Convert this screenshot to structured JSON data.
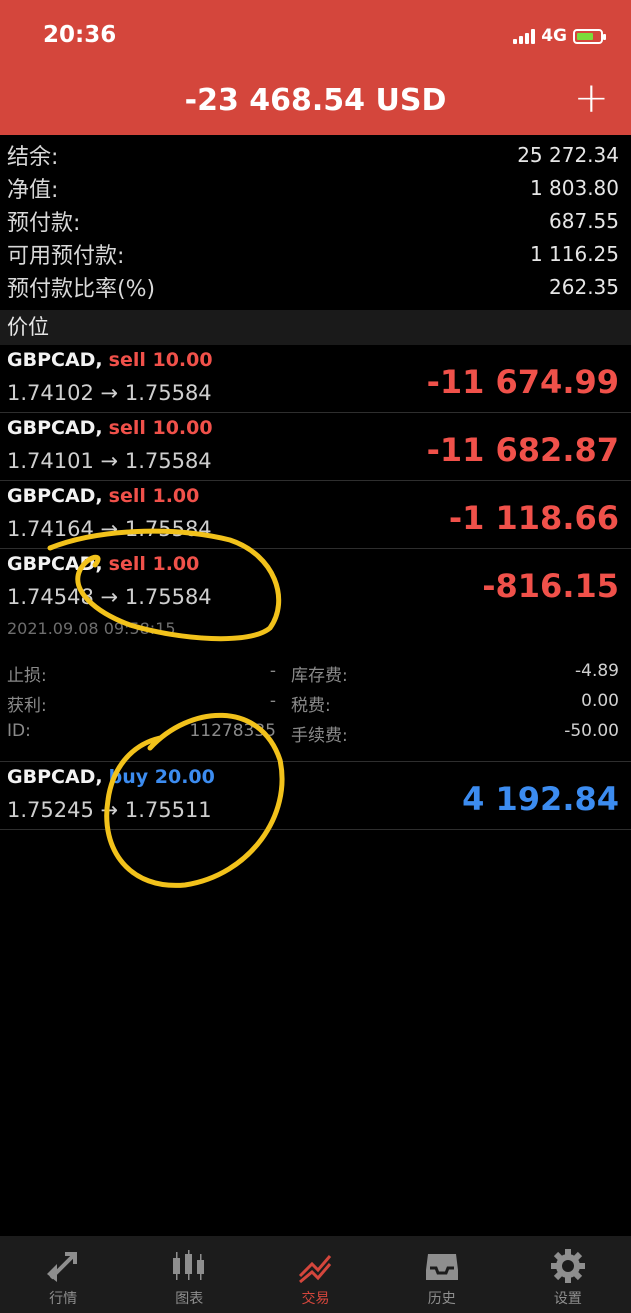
{
  "status": {
    "time": "20:36",
    "network": "4G"
  },
  "header": {
    "title": "-23 468.54 USD",
    "add_label": "+"
  },
  "summary": [
    {
      "label": "结余:",
      "value": "25 272.34"
    },
    {
      "label": "净值:",
      "value": "1 803.80"
    },
    {
      "label": "预付款:",
      "value": "687.55"
    },
    {
      "label": "可用预付款:",
      "value": "1 116.25"
    },
    {
      "label": "预付款比率(%)",
      "value": "262.35"
    }
  ],
  "section": {
    "title": "价位"
  },
  "positions": [
    {
      "symbol": "GBPCAD,",
      "side": "sell 10.00",
      "open": "1.74102",
      "arrow": "→",
      "current": "1.75584",
      "profit": "-11 674.99",
      "type": "sell"
    },
    {
      "symbol": "GBPCAD,",
      "side": "sell 10.00",
      "open": "1.74101",
      "arrow": "→",
      "current": "1.75584",
      "profit": "-11 682.87",
      "type": "sell"
    },
    {
      "symbol": "GBPCAD,",
      "side": "sell 1.00",
      "open": "1.74164",
      "arrow": "→",
      "current": "1.75584",
      "profit": "-1 118.66",
      "type": "sell"
    },
    {
      "symbol": "GBPCAD,",
      "side": "sell 1.00",
      "open": "1.74548",
      "arrow": "→",
      "current": "1.75584",
      "profit": "-816.15",
      "type": "sell"
    },
    {
      "symbol": "GBPCAD,",
      "side": "buy 20.00",
      "open": "1.75245",
      "arrow": "→",
      "current": "1.75511",
      "profit": "4 192.84",
      "type": "buy"
    }
  ],
  "detail": {
    "time": "2021.09.08 09:58:15",
    "stop_loss_label": "止损:",
    "stop_loss_value": "-",
    "swap_label": "库存费:",
    "swap_value": "-4.89",
    "take_profit_label": "获利:",
    "take_profit_value": "-",
    "tax_label": "税费:",
    "tax_value": "0.00",
    "id_label": "ID:",
    "id_value": "11278335",
    "commission_label": "手续费:",
    "commission_value": "-50.00"
  },
  "tabs": [
    {
      "label": "行情",
      "icon": "quotes-arrows-icon",
      "active": false
    },
    {
      "label": "图表",
      "icon": "candlestick-chart-icon",
      "active": false
    },
    {
      "label": "交易",
      "icon": "trade-trend-icon",
      "active": true
    },
    {
      "label": "历史",
      "icon": "history-inbox-icon",
      "active": false
    },
    {
      "label": "设置",
      "icon": "settings-gear-icon",
      "active": false
    }
  ],
  "colors": {
    "header": "#d4463c",
    "sell": "#f0514a",
    "buy": "#3c8cf0",
    "annotation": "#f2c21b"
  }
}
